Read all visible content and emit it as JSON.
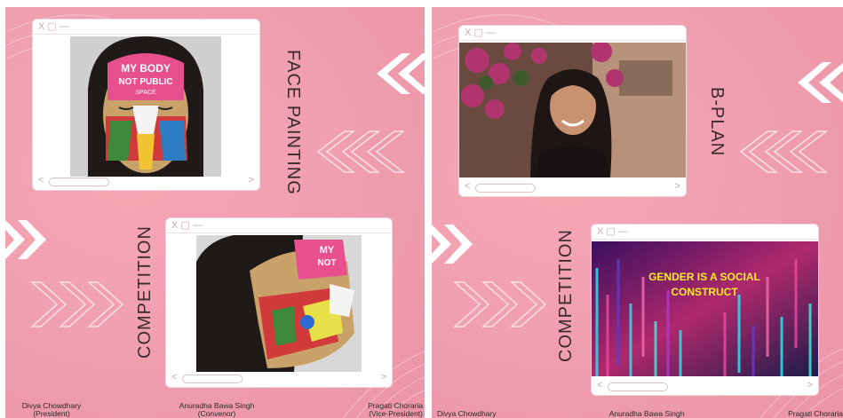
{
  "left": {
    "window_controls": "X ▢ —",
    "title_vertical_top": "FACE PAINTING",
    "title_vertical_bottom": "COMPETITION",
    "photo1_text": {
      "line1": "MY BODY",
      "line2": "NOT PUBLIC",
      "line3": "SPACE"
    },
    "photo2_text": {
      "line1": "MY",
      "line2": "NOT"
    },
    "footer": {
      "person1_name": "Divya Chowdhary",
      "person1_role": "(President)",
      "person2_name": "Anuradha Bawa Singh",
      "person2_role": "(Convenor)",
      "person3_name": "Pragati Choraria",
      "person3_role": "(Vice-President)"
    }
  },
  "right": {
    "window_controls": "X ▢ —",
    "title_vertical_top": "B-PLAN",
    "title_vertical_bottom": "COMPETITION",
    "banner_text": {
      "line1": "GENDER IS A SOCIAL",
      "line2": "CONSTRUCT"
    },
    "footer": {
      "person1_name": "Divya Chowdhary",
      "person2_name": "Anuradha Bawa Singh",
      "person3_name": "Pragati Choraria"
    }
  },
  "colors": {
    "background": "#f0a0b0",
    "accent_text": "#f4ec2c",
    "title": "#3a2a2e"
  },
  "icons": [
    "close-icon",
    "maximize-icon",
    "minimize-icon",
    "scroll-left-icon",
    "scroll-right-icon",
    "chevron-outline-icon",
    "chevron-solid-icon"
  ]
}
